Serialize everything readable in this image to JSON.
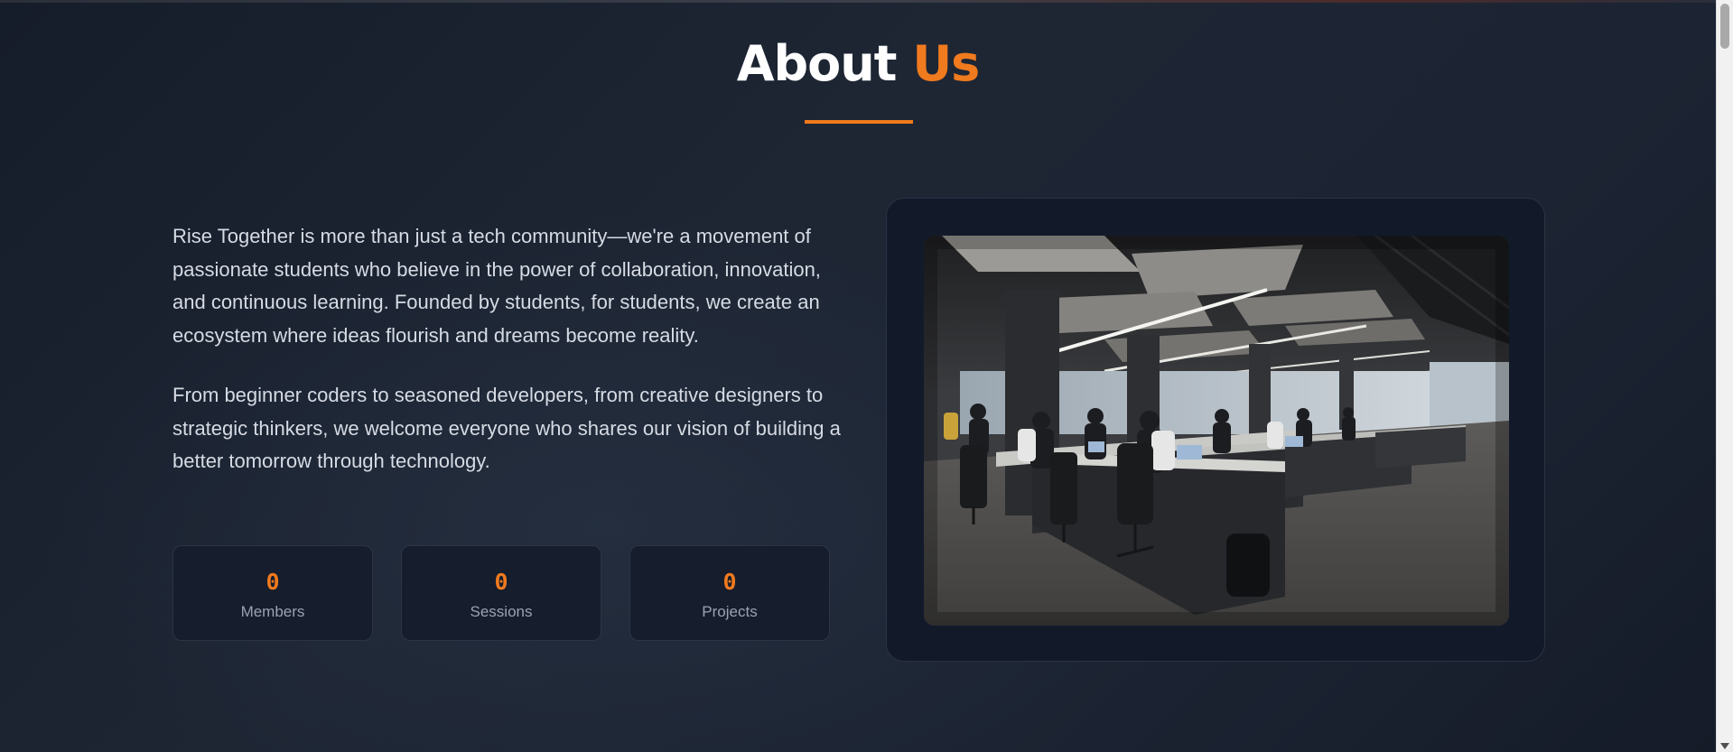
{
  "section": {
    "title_main": "About",
    "title_accent": "Us"
  },
  "about": {
    "paragraphs": [
      "Rise Together is more than just a tech community—we're a movement of passionate students who believe in the power of collaboration, innovation, and continuous learning. Founded by students, for students, we create an ecosystem where ideas flourish and dreams become reality.",
      "From beginner coders to seasoned developers, from creative designers to strategic thinkers, we welcome everyone who shares our vision of building a better tomorrow through technology."
    ]
  },
  "stats": [
    {
      "value": "0",
      "label": "Members"
    },
    {
      "value": "0",
      "label": "Sessions"
    },
    {
      "value": "0",
      "label": "Projects"
    }
  ],
  "image": {
    "alt": ""
  },
  "colors": {
    "accent": "#f07a1e",
    "background": "#1a2230",
    "card": "#161d2c",
    "text": "#d6dbe4",
    "muted": "#9aa3b2"
  }
}
